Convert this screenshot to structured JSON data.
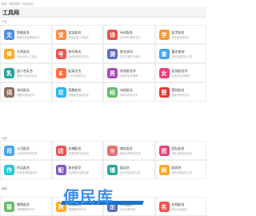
{
  "breadcrumb": "首页 › 便民服务 › 在线起名",
  "site_title": "工具网",
  "sections": [
    {
      "title": "人名",
      "cards": [
        {
          "title": "智能起名",
          "desc": "根据生辰智能取名字",
          "icon": "文",
          "color": "#4b8ee6"
        },
        {
          "title": "宝宝起名",
          "desc": "宝宝生辰八字起名",
          "icon": "宝",
          "color": "#ff8a3d"
        },
        {
          "title": "诗词起名",
          "desc": "古诗词中取好名字",
          "icon": "诗",
          "color": "#e8524a"
        },
        {
          "title": "起字起名",
          "desc": "指定某字起名字",
          "icon": "字",
          "color": "#f49a3b"
        },
        {
          "title": "大师起名",
          "desc": "专业大师人工起名",
          "icon": "师",
          "color": "#ffa726"
        },
        {
          "title": "称号取名",
          "desc": "游戏网名称号生成",
          "icon": "号",
          "color": "#ef5350"
        },
        {
          "title": "姓名测试",
          "desc": "姓名五格打分测试",
          "icon": "测",
          "color": "#5c6bc0"
        },
        {
          "title": "重名查询",
          "desc": "查询全国同名人数",
          "icon": "查",
          "color": "#42a5f5"
        },
        {
          "title": "起小名乳名",
          "desc": "宝宝小名乳名大全",
          "icon": "乳",
          "color": "#26a69a"
        },
        {
          "title": "起英文名",
          "desc": "中文名转英文名",
          "icon": "E",
          "color": "#ff7043"
        },
        {
          "title": "男孩起名字",
          "desc": "男孩好名字推荐",
          "icon": "男",
          "color": "#ab47bc"
        },
        {
          "title": "女孩起名字",
          "desc": "女孩好名字推荐",
          "icon": "女",
          "color": "#ec407a"
        },
        {
          "title": "测词起名",
          "desc": "根据词语测名字",
          "icon": "词",
          "color": "#8d6e63"
        },
        {
          "title": "双胞起名",
          "desc": "双胞胎宝宝起名字",
          "icon": "双",
          "color": "#29b6f6"
        },
        {
          "title": "诗经起名",
          "desc": "诗经中的好名字",
          "icon": "经",
          "color": "#66bb6a"
        },
        {
          "title": "楚辞起名",
          "desc": "楚辞中的好名字",
          "icon": "楚",
          "color": "#e53935"
        }
      ]
    },
    {
      "title": "公司",
      "cards": [
        {
          "title": "公司起名",
          "desc": "公司名称在线生成",
          "icon": "司",
          "color": "#42a5f5"
        },
        {
          "title": "店铺起名",
          "desc": "店铺名称在线生成",
          "icon": "店",
          "color": "#ef5350"
        },
        {
          "title": "商标起名",
          "desc": "商标名称在线生成",
          "icon": "®",
          "color": "#e57373"
        },
        {
          "title": "团队起名",
          "desc": "团队名称在线生成",
          "icon": "团",
          "color": "#ec407a"
        },
        {
          "title": "作品起名",
          "desc": "作品名称在线生成",
          "icon": "作",
          "color": "#26c6da"
        },
        {
          "title": "取名配字",
          "desc": "名字配字在线生成",
          "icon": "配",
          "color": "#7e57c2"
        },
        {
          "title": "起店名",
          "desc": "店名在线生成工具",
          "icon": "铺",
          "color": "#26a69a"
        },
        {
          "title": "起网名",
          "desc": "网名在线生成工具",
          "icon": "网",
          "color": "#ffa726"
        }
      ]
    },
    {
      "title": "其他",
      "cards": [
        {
          "title": "猫咪起名",
          "desc": "宠物猫咪好名字",
          "icon": "猫",
          "color": "#66bb6a"
        },
        {
          "title": "狗狗起名",
          "desc": "宠物狗狗好名字",
          "icon": "狗",
          "color": "#ffa726"
        },
        {
          "title": "公司起名",
          "desc": "企业名称生成",
          "icon": "企",
          "color": "#5c6bc0"
        },
        {
          "title": "在线起名",
          "desc": "综合在线起名",
          "icon": "名",
          "color": "#ef5350"
        }
      ]
    }
  ],
  "watermark": "便民库"
}
